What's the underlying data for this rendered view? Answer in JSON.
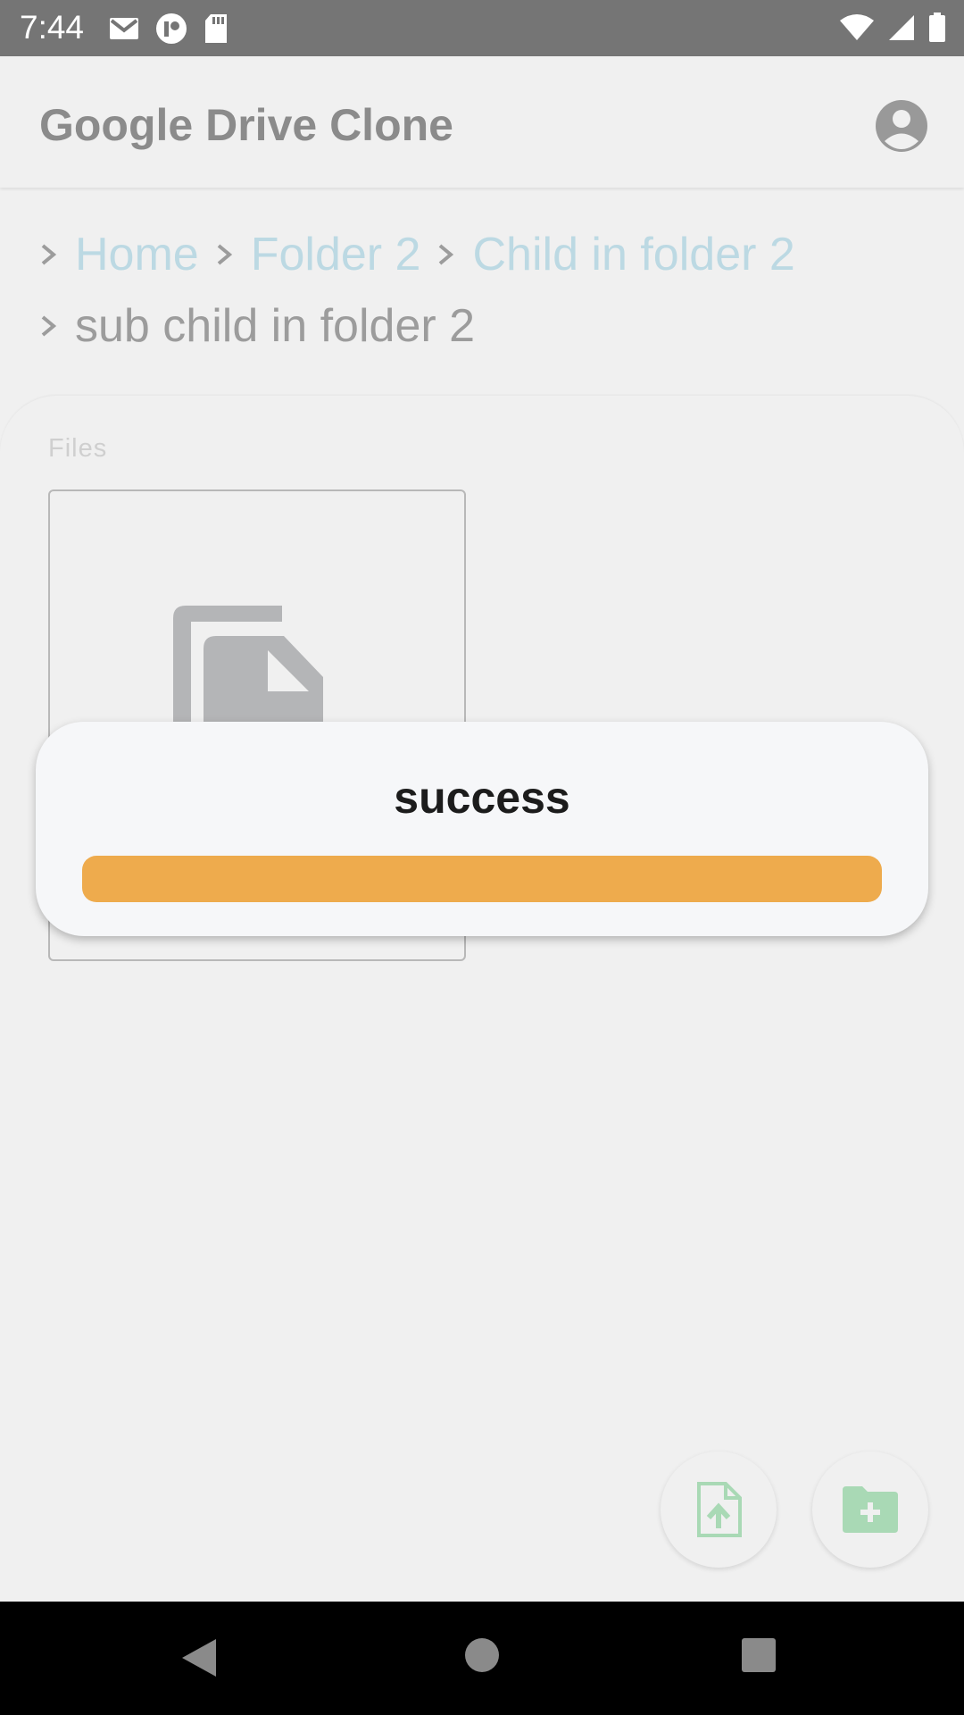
{
  "status_bar": {
    "time": "7:44",
    "left_icons": [
      "gmail-icon",
      "app-notification-icon",
      "sd-card-icon"
    ],
    "right_icons": [
      "wifi-icon",
      "cellular-signal-icon",
      "battery-icon"
    ]
  },
  "app_bar": {
    "title": "Google Drive Clone",
    "account_icon": "account-circle-icon"
  },
  "breadcrumb": {
    "separator_icon": "chevron-right-icon",
    "items": [
      {
        "label": "Home"
      },
      {
        "label": "Folder 2"
      },
      {
        "label": "Child in folder 2"
      },
      {
        "label": "sub child in folder 2"
      }
    ]
  },
  "files": {
    "section_label": "Files",
    "card_icon": "file-copy-icon"
  },
  "dialog": {
    "title": "success",
    "button_color": "#eeab4d"
  },
  "fabs": {
    "upload_icon": "upload-file-icon",
    "new_folder_icon": "create-folder-icon",
    "accent_color": "#a9d9b5"
  },
  "nav_bar": {
    "icons": [
      "back-triangle-icon",
      "home-circle-icon",
      "recents-square-icon"
    ]
  }
}
